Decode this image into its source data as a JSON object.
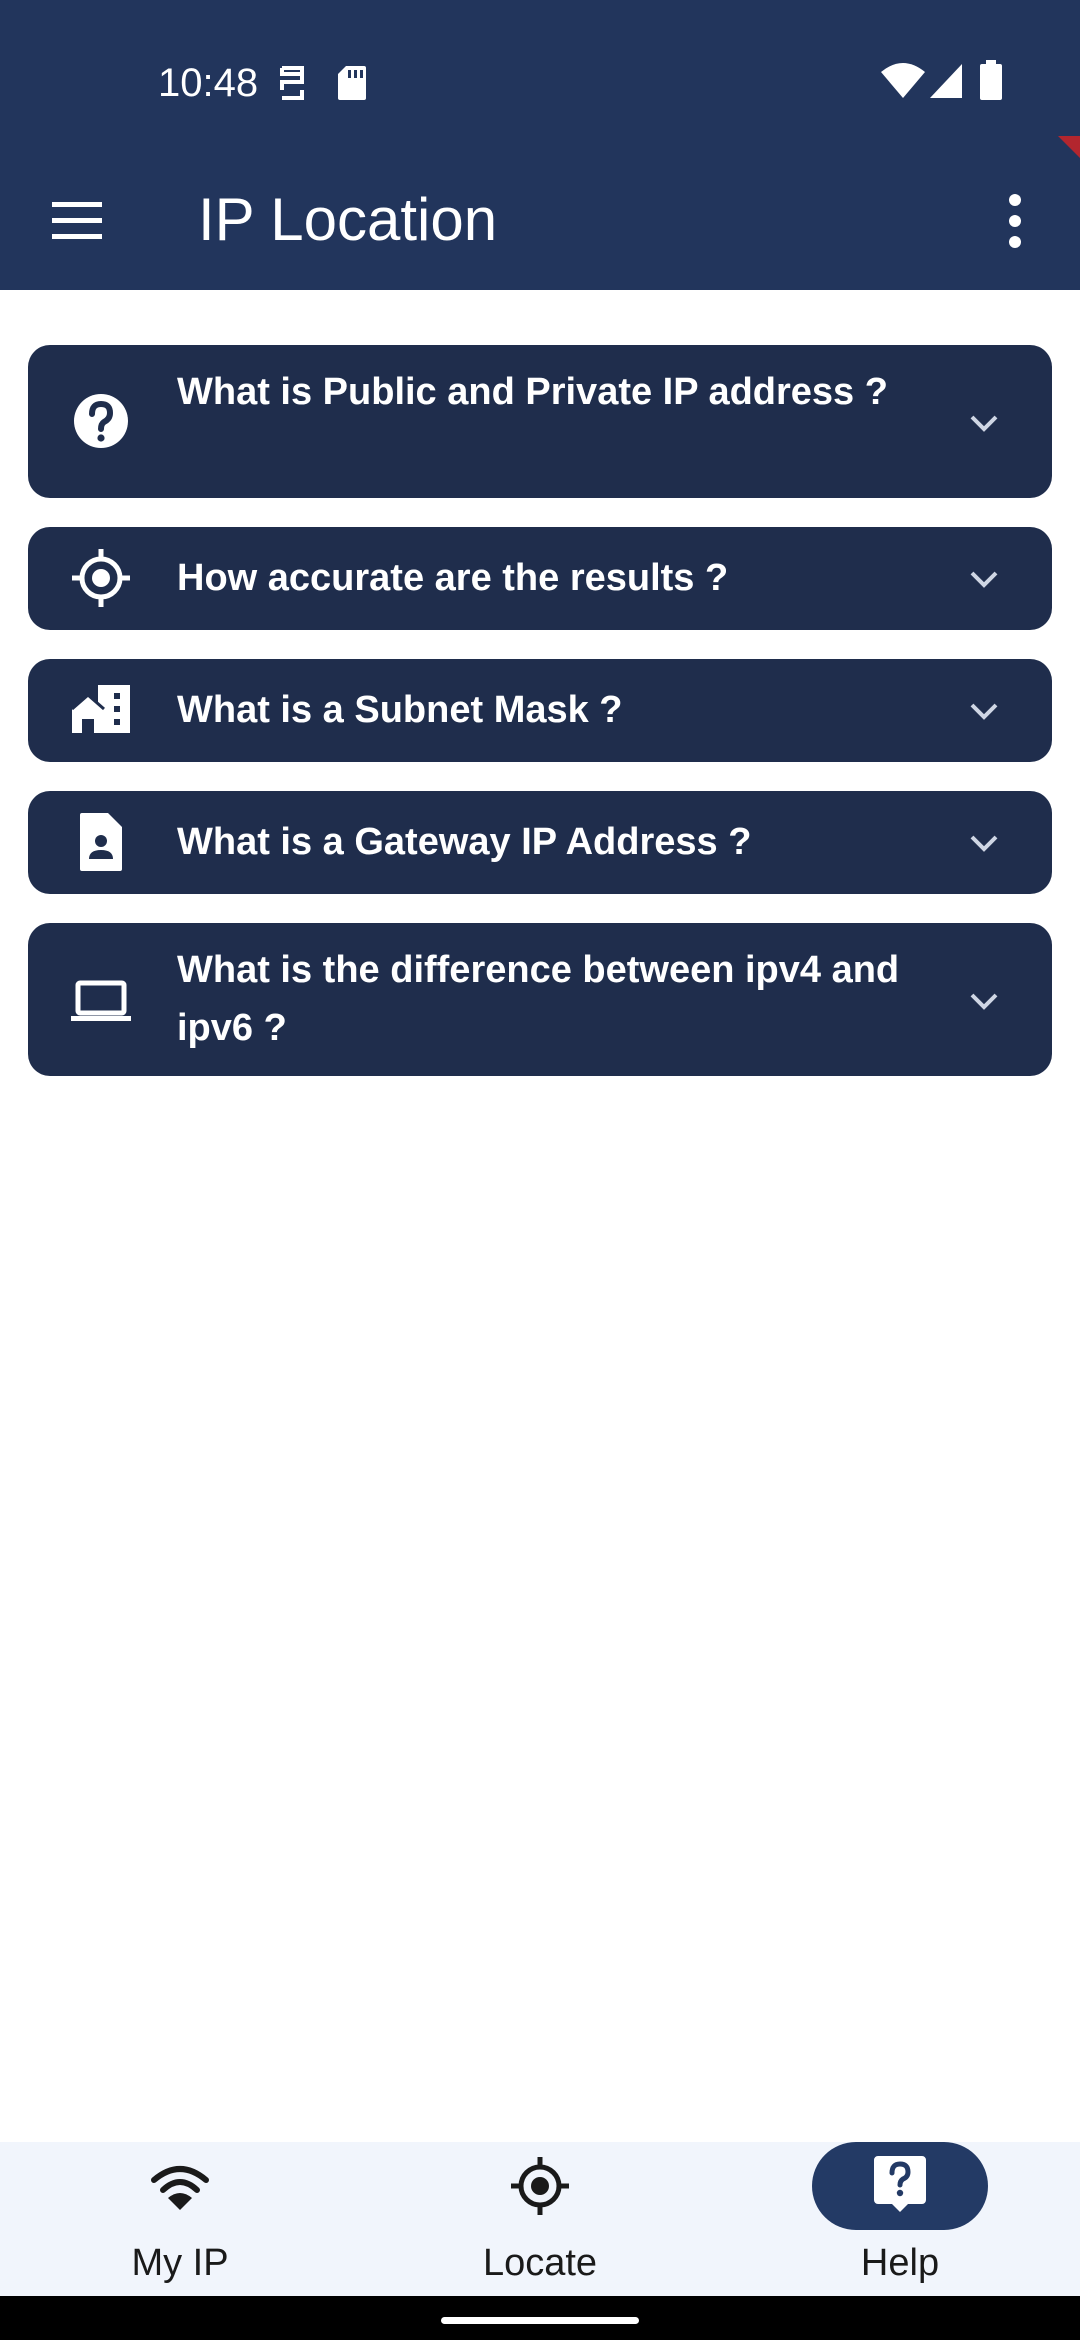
{
  "status_bar": {
    "time": "10:48",
    "icons": [
      "sim-icon",
      "sd-card-icon",
      "wifi-icon",
      "signal-icon",
      "battery-icon"
    ]
  },
  "app_bar": {
    "title": "IP Location",
    "icons": [
      "hamburger-menu-icon",
      "overflow-menu-icon"
    ]
  },
  "faq": [
    {
      "question": "What is Public and Private IP address ?",
      "icon": "help-circle-icon"
    },
    {
      "question": "How accurate are the results ?",
      "icon": "gps-fixed-icon"
    },
    {
      "question": "What is a Subnet Mask ?",
      "icon": "building-icon"
    },
    {
      "question": "What is a Gateway IP Address ?",
      "icon": "contact-card-icon"
    },
    {
      "question": "What is the difference between ipv4 and ipv6 ?",
      "icon": "laptop-icon"
    }
  ],
  "bottom_nav": [
    {
      "label": "My IP",
      "icon": "wifi-icon",
      "selected": false
    },
    {
      "label": "Locate",
      "icon": "gps-fixed-icon",
      "selected": false
    },
    {
      "label": "Help",
      "icon": "help-bubble-icon",
      "selected": true
    }
  ],
  "colors": {
    "app_bar": "#22355c",
    "card": "#1f2d4c",
    "nav_background": "#f1f5fc",
    "selected_pill": "#233a65",
    "accent_flag": "#b3262e"
  }
}
